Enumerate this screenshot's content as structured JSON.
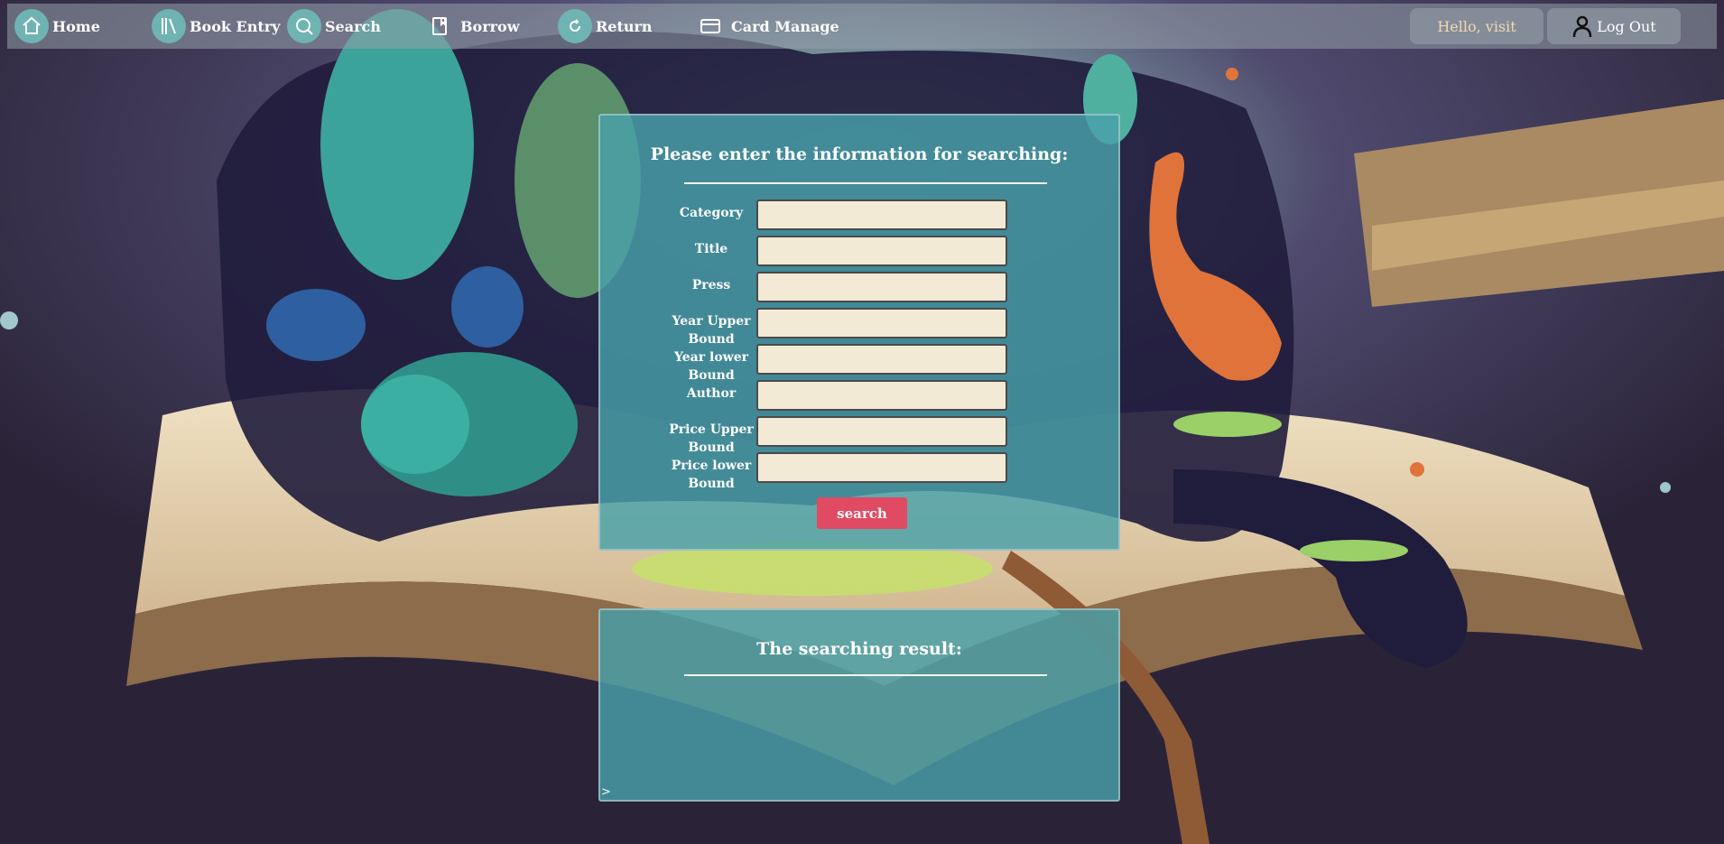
{
  "nav": {
    "items": [
      {
        "label": "Home",
        "icon": "home-icon"
      },
      {
        "label": "Book Entry",
        "icon": "books-icon"
      },
      {
        "label": "Search",
        "icon": "magnifier-icon"
      },
      {
        "label": "Borrow",
        "icon": "book-icon"
      },
      {
        "label": "Return",
        "icon": "return-icon"
      },
      {
        "label": "Card Manage",
        "icon": "card-icon"
      }
    ],
    "greeting": "Hello, visit",
    "logout_label": "Log Out"
  },
  "search_panel": {
    "title": "Please enter the information for searching:",
    "fields": [
      {
        "label": "Category",
        "value": ""
      },
      {
        "label": "Title",
        "value": ""
      },
      {
        "label": "Press",
        "value": ""
      },
      {
        "label": "Year Upper Bound",
        "value": ""
      },
      {
        "label": "Year lower Bound",
        "value": ""
      },
      {
        "label": "Author",
        "value": ""
      },
      {
        "label": "Price Upper Bound",
        "value": ""
      },
      {
        "label": "Price lower Bound",
        "value": ""
      }
    ],
    "button_label": "search"
  },
  "result_panel": {
    "title": "The searching result:",
    "prompt": ">"
  },
  "colors": {
    "panel": "#48a0aa",
    "input_bg": "#f2ead4",
    "button": "#e04a62",
    "nav_icon": "#6fb3b2",
    "greeting": "#f2d7b0"
  }
}
